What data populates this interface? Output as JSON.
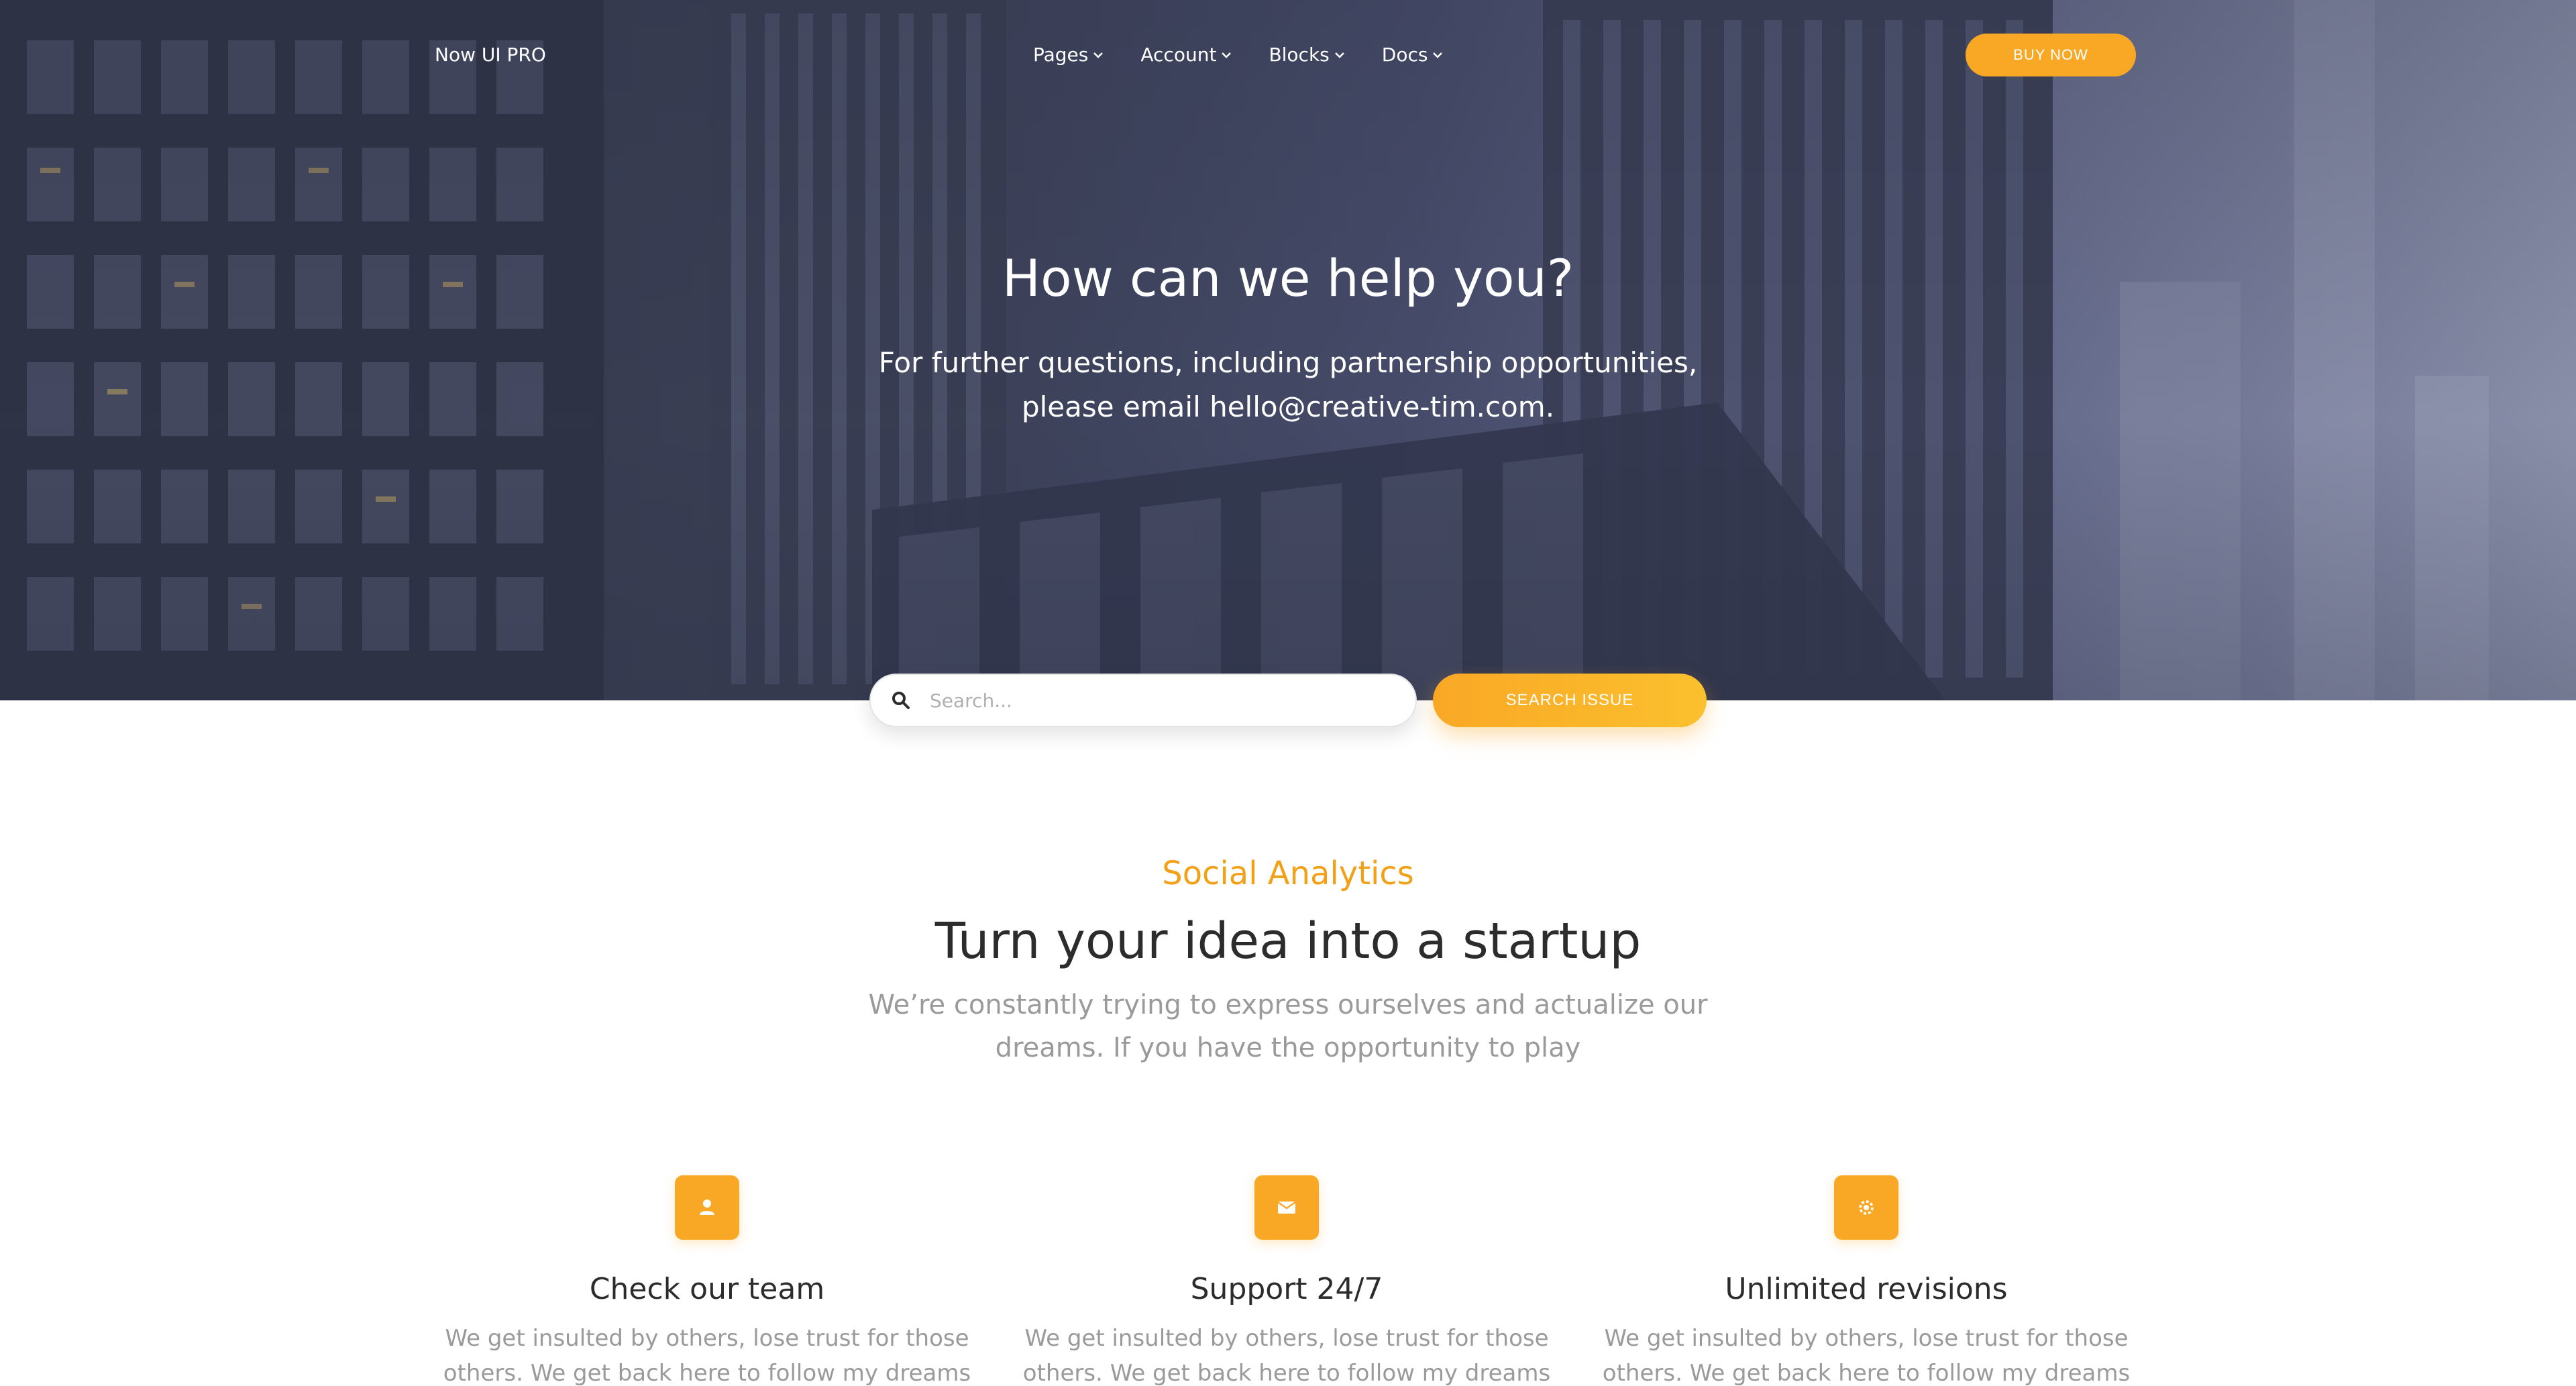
{
  "nav": {
    "brand": "Now UI PRO",
    "items": [
      {
        "label": "Pages"
      },
      {
        "label": "Account"
      },
      {
        "label": "Blocks"
      },
      {
        "label": "Docs"
      }
    ],
    "cta_label": "BUY NOW"
  },
  "hero": {
    "title": "How can we help you?",
    "subtitle_line1": "For further questions, including partnership opportunities,",
    "subtitle_line2": "please email hello@creative-tim.com."
  },
  "search": {
    "placeholder": "Search...",
    "value": "",
    "button_label": "SEARCH ISSUE"
  },
  "section": {
    "eyebrow": "Social Analytics",
    "title": "Turn your idea into a startup",
    "description_line1": "We’re constantly trying to express ourselves and actualize our",
    "description_line2": "dreams. If you have the opportunity to play"
  },
  "features": [
    {
      "icon": "user-icon",
      "title": "Check our team",
      "text_line1": "We get insulted by others, lose trust for those",
      "text_line2": "others. We get back here to follow my dreams"
    },
    {
      "icon": "email-icon",
      "title": "Support 24/7",
      "text_line1": "We get insulted by others, lose trust for those",
      "text_line2": "others. We get back here to follow my dreams"
    },
    {
      "icon": "settings-icon",
      "title": "Unlimited revisions",
      "text_line1": "We get insulted by others, lose trust for those",
      "text_line2": "others. We get back here to follow my dreams"
    }
  ],
  "colors": {
    "accent": "#f9a825",
    "eyebrow": "#f2a116",
    "hero_overlay": "#3d4259",
    "heading": "#2c2c2c",
    "muted": "#9a9a9a"
  }
}
